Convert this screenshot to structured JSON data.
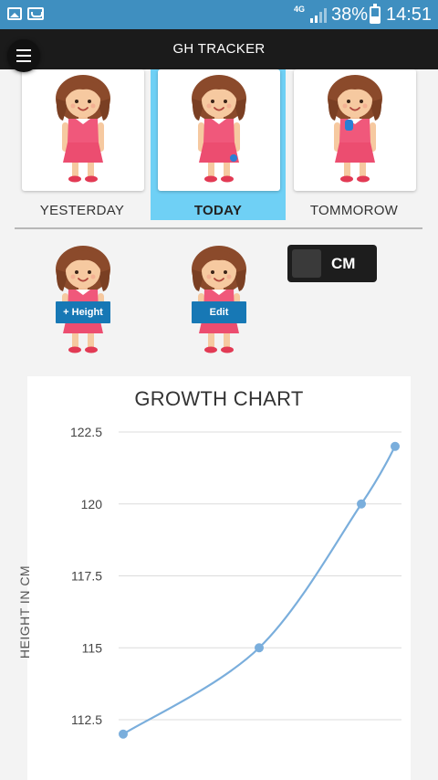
{
  "status_bar": {
    "network_label": "4G",
    "battery_percent": "38%",
    "time": "14:51"
  },
  "app_bar": {
    "title": "GH TRACKER"
  },
  "days": [
    {
      "label": "YESTERDAY",
      "selected": false
    },
    {
      "label": "TODAY",
      "selected": true
    },
    {
      "label": "TOMMOROW",
      "selected": false
    }
  ],
  "actions": {
    "add_height_label": "+ Height",
    "edit_label": "Edit"
  },
  "unit_toggle": {
    "label": "CM",
    "on": false
  },
  "colors": {
    "accent": "#6fd0f5",
    "status_bar": "#3f8fc0",
    "app_bar": "#1b1b1b",
    "button": "#1778b5",
    "line": "#7aaedc"
  },
  "chart_data": {
    "type": "line",
    "title": "GROWTH CHART",
    "ylabel": "HEIGHT IN CM",
    "xlabel": "",
    "yticks": [
      "122.5",
      "120",
      "117.5",
      "115",
      "112.5"
    ],
    "ylim": [
      112,
      122.5
    ],
    "grid": true,
    "series": [
      {
        "values": [
          112,
          115,
          120,
          122
        ]
      }
    ]
  }
}
